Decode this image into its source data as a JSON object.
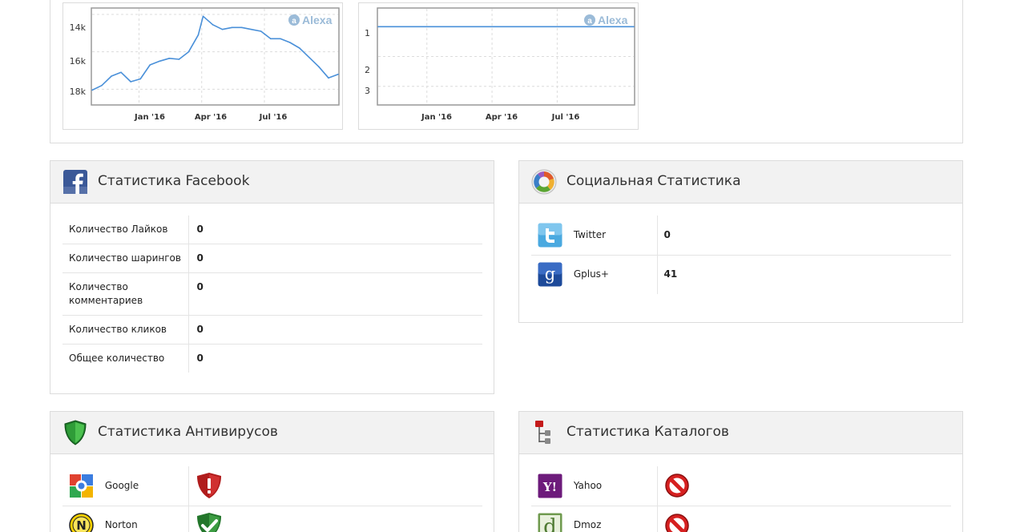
{
  "alexa": {
    "brand": "Alexa",
    "rank_chart": {
      "type": "line",
      "y_ticks": [
        "14k",
        "16k",
        "18k"
      ],
      "x_ticks": [
        "Jan '16",
        "Apr '16",
        "Jul '16"
      ]
    },
    "reach_chart": {
      "type": "line",
      "y_ticks": [
        "1",
        "2",
        "3"
      ],
      "x_ticks": [
        "Jan '16",
        "Apr '16",
        "Jul '16"
      ]
    }
  },
  "chart_data": [
    {
      "type": "line",
      "yscale": "inverted",
      "ylim": [
        18800,
        13700
      ],
      "x": [
        "2015-10-25",
        "2015-11-08",
        "2015-11-22",
        "2015-12-06",
        "2015-12-20",
        "2016-01-03",
        "2016-01-17",
        "2016-01-31",
        "2016-02-14",
        "2016-02-28",
        "2016-03-13",
        "2016-03-27",
        "2016-04-03",
        "2016-04-17",
        "2016-05-01",
        "2016-05-15",
        "2016-05-29",
        "2016-06-12",
        "2016-06-26",
        "2016-07-10",
        "2016-07-24",
        "2016-08-07",
        "2016-08-21",
        "2016-09-04",
        "2016-09-18",
        "2016-10-02",
        "2016-10-16"
      ],
      "y": [
        18050,
        17800,
        17300,
        17100,
        17600,
        17450,
        16700,
        16500,
        16350,
        16400,
        16000,
        15100,
        14100,
        14550,
        14800,
        14700,
        14700,
        14800,
        14900,
        15300,
        15300,
        15500,
        15800,
        16300,
        16800,
        17400,
        17200
      ]
    },
    {
      "type": "line",
      "yscale": "inverted",
      "ylim": [
        3.6,
        0.4
      ],
      "x": [
        "2015-10-25",
        "2016-10-16"
      ],
      "y": [
        1,
        1
      ]
    }
  ],
  "facebook": {
    "title": "Статистика Facebook",
    "icon": "facebook-icon",
    "rows": [
      {
        "label": "Количество Лайков",
        "value": "0"
      },
      {
        "label": "Количество шарингов",
        "value": "0"
      },
      {
        "label": "Количество комментариев",
        "value": "0"
      },
      {
        "label": "Количество кликов",
        "value": "0"
      },
      {
        "label": "Общее количество",
        "value": "0"
      }
    ]
  },
  "social": {
    "title": "Социальная Статистика",
    "icon": "social-chart-icon",
    "rows": [
      {
        "label": "Twitter",
        "value": "0",
        "icon": "twitter-icon"
      },
      {
        "label": "Gplus+",
        "value": "41",
        "icon": "google-plus-icon"
      }
    ]
  },
  "antivirus": {
    "title": "Статистика Антивирусов",
    "icon": "green-shield-icon",
    "rows": [
      {
        "label": "Google",
        "status": "warning",
        "icon": "google-icon"
      },
      {
        "label": "Norton",
        "status": "safe",
        "icon": "norton-icon"
      }
    ]
  },
  "catalogs": {
    "title": "Статистика Каталогов",
    "icon": "directory-tree-icon",
    "rows": [
      {
        "label": "Yahoo",
        "status": "not-listed",
        "icon": "yahoo-icon"
      },
      {
        "label": "Dmoz",
        "status": "not-listed",
        "icon": "dmoz-icon"
      }
    ]
  },
  "colors": {
    "line": "#4a90d9",
    "panel_header": "#f2f2f2",
    "border": "#dcdcdc",
    "facebook": "#3b5998",
    "danger": "#c0201e",
    "safe": "#2f8a2f"
  }
}
